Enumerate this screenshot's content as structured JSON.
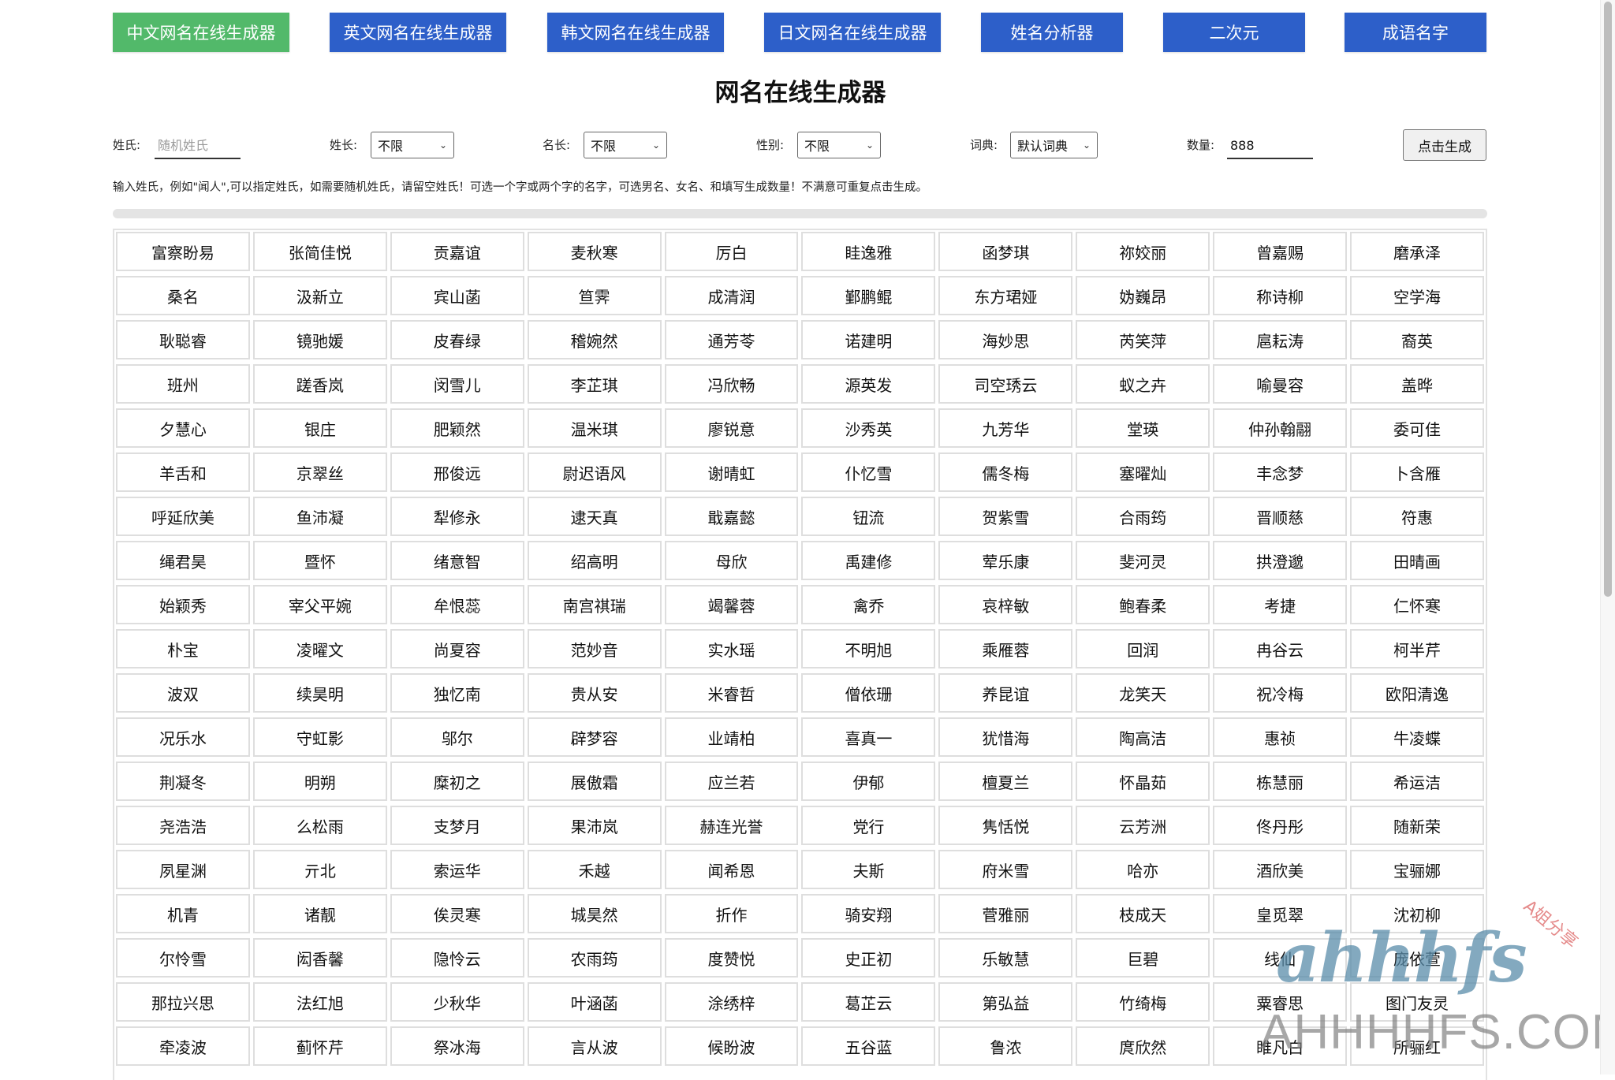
{
  "nav": [
    {
      "label": "中文网名在线生成器",
      "active": true
    },
    {
      "label": "英文网名在线生成器",
      "active": false
    },
    {
      "label": "韩文网名在线生成器",
      "active": false
    },
    {
      "label": "日文网名在线生成器",
      "active": false
    },
    {
      "label": "姓名分析器",
      "active": false
    },
    {
      "label": "二次元",
      "active": false
    },
    {
      "label": "成语名字",
      "active": false
    }
  ],
  "colors": {
    "active": "#52b96a",
    "nav": "#2d5fc9"
  },
  "title": "网名在线生成器",
  "form": {
    "surname_label": "姓氏:",
    "surname_placeholder": "随机姓氏",
    "surname_value": "",
    "surname_len_label": "姓长:",
    "surname_len_value": "不限",
    "name_len_label": "名长:",
    "name_len_value": "不限",
    "gender_label": "性别:",
    "gender_value": "不限",
    "dict_label": "词典:",
    "dict_value": "默认词典",
    "count_label": "数量:",
    "count_value": "888",
    "generate_label": "点击生成"
  },
  "hint": "输入姓氏，例如\"闻人\",可以指定姓氏，如需要随机姓氏，请留空姓氏！可选一个字或两个字的名字，可选男名、女名、和填写生成数量！不满意可重复点击生成。",
  "progress": 1.0,
  "names": [
    [
      "富察盼易",
      "张简佳悦",
      "贡嘉谊",
      "麦秋寒",
      "厉白",
      "眭逸雅",
      "函梦琪",
      "祢姣丽",
      "曾嘉赐",
      "磨承泽"
    ],
    [
      "桑名",
      "汲新立",
      "宾山菡",
      "笪霁",
      "成清润",
      "鄞鹏鲲",
      "东方珺娅",
      "妫巍昂",
      "称诗柳",
      "空学海"
    ],
    [
      "耿聪睿",
      "镜驰媛",
      "皮春绿",
      "稽婉然",
      "通芳苓",
      "诺建明",
      "海妙思",
      "芮笑萍",
      "扈耘涛",
      "裔英"
    ],
    [
      "班州",
      "蹉香岚",
      "闵雪儿",
      "李芷琪",
      "冯欣畅",
      "源英发",
      "司空琇云",
      "蚁之卉",
      "喻曼容",
      "盖晔"
    ],
    [
      "夕慧心",
      "银庄",
      "肥颖然",
      "温米琪",
      "廖锐意",
      "沙秀英",
      "九芳华",
      "堂瑛",
      "仲孙翰翮",
      "委可佳"
    ],
    [
      "羊舌和",
      "京翠丝",
      "邢俊远",
      "尉迟语风",
      "谢晴虹",
      "仆忆雪",
      "儒冬梅",
      "塞曜灿",
      "丰念梦",
      "卜含雁"
    ],
    [
      "呼延欣美",
      "鱼沛凝",
      "犁修永",
      "逮天真",
      "戢嘉懿",
      "钮流",
      "贺紫雪",
      "合雨筠",
      "晋顺慈",
      "符惠"
    ],
    [
      "绳君昊",
      "暨怀",
      "绪意智",
      "绍高明",
      "母欣",
      "禹建修",
      "荤乐康",
      "斐河灵",
      "拱澄邈",
      "田晴画"
    ],
    [
      "始颖秀",
      "宰父平婉",
      "牟恨蕊",
      "南宫祺瑞",
      "竭馨蓉",
      "禽乔",
      "哀梓敏",
      "鲍春柔",
      "考捷",
      "仁怀寒"
    ],
    [
      "朴宝",
      "凌曜文",
      "尚夏容",
      "范妙音",
      "实水瑶",
      "不明旭",
      "乘雁蓉",
      "回润",
      "冉谷云",
      "柯半芹"
    ],
    [
      "波双",
      "续昊明",
      "独忆南",
      "贵从安",
      "米睿哲",
      "僧依珊",
      "养昆谊",
      "龙笑天",
      "祝冷梅",
      "欧阳清逸"
    ],
    [
      "况乐水",
      "守虹影",
      "邬尔",
      "辟梦容",
      "业靖柏",
      "喜真一",
      "犹惜海",
      "陶高洁",
      "惠祯",
      "牛凌蝶"
    ],
    [
      "荆凝冬",
      "明朔",
      "糜初之",
      "展傲霜",
      "应兰若",
      "伊郁",
      "檀夏兰",
      "怀晶茹",
      "栋慧丽",
      "希运洁"
    ],
    [
      "尧浩浩",
      "么松雨",
      "支梦月",
      "果沛岚",
      "赫连光誉",
      "党行",
      "隽恬悦",
      "云芳洲",
      "佟丹彤",
      "随新荣"
    ],
    [
      "夙星渊",
      "亓北",
      "索运华",
      "禾越",
      "闻希恩",
      "夫斯",
      "府米雪",
      "哈亦",
      "酒欣美",
      "宝骊娜"
    ],
    [
      "机青",
      "诸靓",
      "俟灵寒",
      "城昊然",
      "折作",
      "骑安翔",
      "菅雅丽",
      "枝成天",
      "皇觅翠",
      "沈初柳"
    ],
    [
      "尔怜雪",
      "闳香馨",
      "隐怜云",
      "农雨筠",
      "度赞悦",
      "史正初",
      "乐敏慧",
      "巨碧",
      "线仙",
      "庞依萱"
    ],
    [
      "那拉兴思",
      "法红旭",
      "少秋华",
      "叶涵菡",
      "涂绣梓",
      "葛芷云",
      "第弘益",
      "竹绮梅",
      "粟睿思",
      "图门友灵"
    ],
    [
      "牵凌波",
      "蓟怀芹",
      "祭冰海",
      "言从波",
      "候盼波",
      "五谷蓝",
      "鲁浓",
      "庹欣然",
      "睢凡白",
      "所骊红"
    ]
  ],
  "watermark": {
    "script": "ahhhfs",
    "domain": "AHHHHFS.COM",
    "tag": "A姐分享"
  }
}
